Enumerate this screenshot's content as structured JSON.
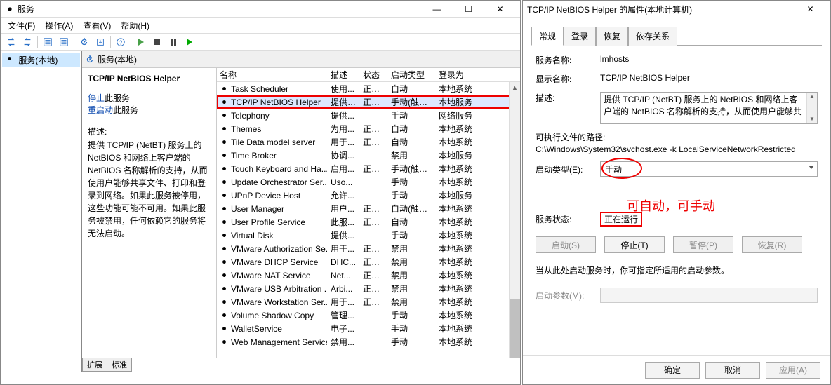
{
  "window": {
    "title": "服务",
    "menu": {
      "file": "文件(F)",
      "action": "操作(A)",
      "view": "查看(V)",
      "help": "帮助(H)"
    }
  },
  "tree": {
    "root": "服务(本地)"
  },
  "content": {
    "header": "服务(本地)",
    "selected_title": "TCP/IP NetBIOS Helper",
    "stop_label": "停止",
    "stop_tail": "此服务",
    "restart_label": "重启动",
    "restart_tail": "此服务",
    "desc_label": "描述:",
    "desc_text": "提供 TCP/IP (NetBT) 服务上的 NetBIOS 和网络上客户端的 NetBIOS 名称解析的支持，从而使用户能够共享文件、打印和登录到网络。如果此服务被停用，这些功能可能不可用。如果此服务被禁用，任何依赖它的服务将无法启动。"
  },
  "columns": {
    "name": "名称",
    "desc": "描述",
    "status": "状态",
    "start": "启动类型",
    "logon": "登录为"
  },
  "rows": [
    {
      "name": "Task Scheduler",
      "desc": "使用...",
      "status": "正在...",
      "start": "自动",
      "logon": "本地系统"
    },
    {
      "name": "TCP/IP NetBIOS Helper",
      "desc": "提供 ...",
      "status": "正在...",
      "start": "手动(触发...",
      "logon": "本地服务",
      "hl": true
    },
    {
      "name": "Telephony",
      "desc": "提供...",
      "status": "",
      "start": "手动",
      "logon": "网络服务"
    },
    {
      "name": "Themes",
      "desc": "为用...",
      "status": "正在...",
      "start": "自动",
      "logon": "本地系统"
    },
    {
      "name": "Tile Data model server",
      "desc": "用于...",
      "status": "正在...",
      "start": "自动",
      "logon": "本地系统"
    },
    {
      "name": "Time Broker",
      "desc": "协调...",
      "status": "",
      "start": "禁用",
      "logon": "本地服务"
    },
    {
      "name": "Touch Keyboard and Ha...",
      "desc": "启用...",
      "status": "正在...",
      "start": "手动(触发...",
      "logon": "本地系统"
    },
    {
      "name": "Update Orchestrator Ser...",
      "desc": "Uso...",
      "status": "",
      "start": "手动",
      "logon": "本地系统"
    },
    {
      "name": "UPnP Device Host",
      "desc": "允许...",
      "status": "",
      "start": "手动",
      "logon": "本地服务"
    },
    {
      "name": "User Manager",
      "desc": "用户...",
      "status": "正在...",
      "start": "自动(触发...",
      "logon": "本地系统"
    },
    {
      "name": "User Profile Service",
      "desc": "此服...",
      "status": "正在...",
      "start": "自动",
      "logon": "本地系统"
    },
    {
      "name": "Virtual Disk",
      "desc": "提供...",
      "status": "",
      "start": "手动",
      "logon": "本地系统"
    },
    {
      "name": "VMware Authorization Se...",
      "desc": "用于...",
      "status": "正在...",
      "start": "禁用",
      "logon": "本地系统"
    },
    {
      "name": "VMware DHCP Service",
      "desc": "DHC...",
      "status": "正在...",
      "start": "禁用",
      "logon": "本地系统"
    },
    {
      "name": "VMware NAT Service",
      "desc": "Net...",
      "status": "正在...",
      "start": "禁用",
      "logon": "本地系统"
    },
    {
      "name": "VMware USB Arbitration ...",
      "desc": "Arbi...",
      "status": "正在...",
      "start": "禁用",
      "logon": "本地系统"
    },
    {
      "name": "VMware Workstation Ser...",
      "desc": "用于...",
      "status": "正在...",
      "start": "禁用",
      "logon": "本地系统"
    },
    {
      "name": "Volume Shadow Copy",
      "desc": "管理...",
      "status": "",
      "start": "手动",
      "logon": "本地系统"
    },
    {
      "name": "WalletService",
      "desc": "电子...",
      "status": "",
      "start": "手动",
      "logon": "本地系统"
    },
    {
      "name": "Web Management Service",
      "desc": "禁用...",
      "status": "",
      "start": "手动",
      "logon": "本地系统"
    }
  ],
  "foot_tabs": {
    "ext": "扩展",
    "std": "标准"
  },
  "dlg": {
    "title": "TCP/IP NetBIOS Helper 的属性(本地计算机)",
    "tabs": {
      "general": "常规",
      "logon": "登录",
      "recovery": "恢复",
      "deps": "依存关系"
    },
    "svcname_label": "服务名称:",
    "svcname": "lmhosts",
    "dispname_label": "显示名称:",
    "dispname": "TCP/IP NetBIOS Helper",
    "desc_label": "描述:",
    "desc_text": "提供 TCP/IP (NetBT) 服务上的 NetBIOS 和网络上客户端的 NetBIOS 名称解析的支持，从而使用户能够共",
    "path_label": "可执行文件的路径:",
    "path": "C:\\Windows\\System32\\svchost.exe -k LocalServiceNetworkRestricted",
    "starttype_label": "启动类型(E):",
    "starttype": "手动",
    "note": "可自动，可手动",
    "status_label": "服务状态:",
    "status": "正在运行",
    "btn_start": "启动(S)",
    "btn_stop": "停止(T)",
    "btn_pause": "暂停(P)",
    "btn_resume": "恢复(R)",
    "params_hint": "当从此处启动服务时，你可指定所适用的启动参数。",
    "params_label": "启动参数(M):",
    "ok": "确定",
    "cancel": "取消",
    "apply": "应用(A)"
  }
}
